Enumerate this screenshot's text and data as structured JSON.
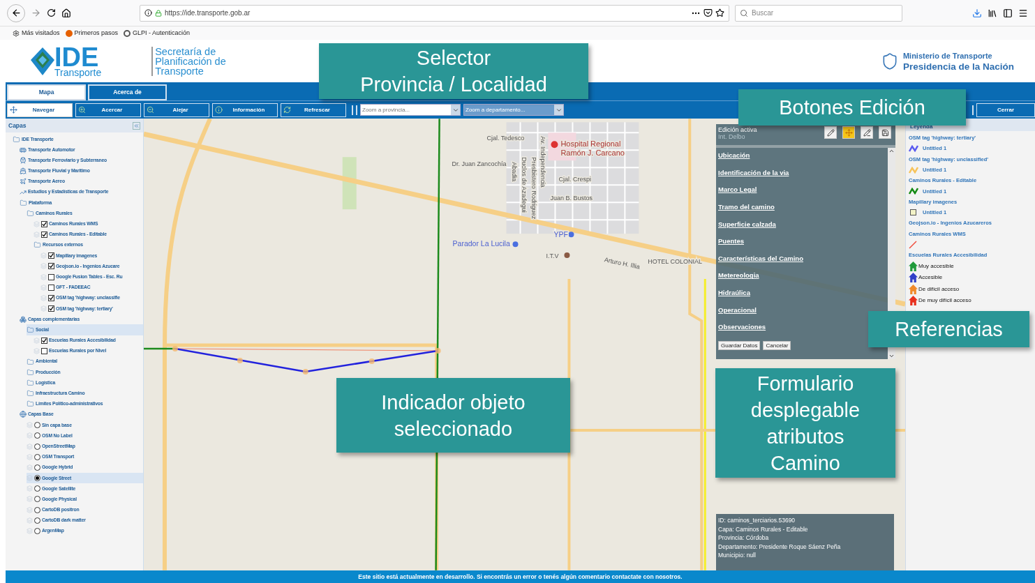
{
  "browser": {
    "url": "https://ide.transporte.gob.ar",
    "search": {
      "placeholder": "Buscar"
    },
    "bookmarks": [
      "Más visitados",
      "Primeros pasos",
      "GLPI - Autenticación"
    ]
  },
  "header": {
    "logo_main": "IDE",
    "logo_sub": "Transporte",
    "secretaria": [
      "Secretaría de",
      "Planificación de",
      "Transporte"
    ],
    "ministry": [
      "Ministerio de Transporte",
      "Presidencia de la Nación"
    ]
  },
  "tabs": [
    {
      "label": "Mapa",
      "selected": true
    },
    {
      "label": "Acerca de",
      "selected": false
    }
  ],
  "toolbar": {
    "tools": [
      {
        "label": "Navegar",
        "selected": true
      },
      {
        "label": "Acercar",
        "selected": false
      },
      {
        "label": "Alejar",
        "selected": false
      },
      {
        "label": "Información",
        "selected": false
      },
      {
        "label": "Refrescar",
        "selected": false
      }
    ],
    "selects": [
      {
        "placeholder": "Zoom a provincia..."
      },
      {
        "placeholder": "Zoom a departamento..."
      }
    ],
    "close": "Cerrar"
  },
  "layers": {
    "title": "Capas",
    "tree": [
      {
        "kind": "folder",
        "label": "IDE Transporte",
        "selected": false,
        "children": [
          {
            "kind": "theme",
            "label": "Transporte Automotor",
            "selected": false
          },
          {
            "kind": "theme",
            "label": "Transporte Ferroviario y Subterraneo",
            "selected": false
          },
          {
            "kind": "theme",
            "label": "Transporte Fluvial y Maritimo",
            "selected": false
          },
          {
            "kind": "theme",
            "label": "Transporte Aereo",
            "selected": false
          },
          {
            "kind": "theme",
            "label": "Estudios y Estadísticas de Transporte",
            "selected": false
          },
          {
            "kind": "folder",
            "label": "Plataforma",
            "selected": false,
            "children": [
              {
                "kind": "folder",
                "label": "Caminos Rurales",
                "selected": false,
                "children": [
                  {
                    "kind": "check",
                    "label": "Caminos Rurales WMS",
                    "checked": true,
                    "selected": false
                  },
                  {
                    "kind": "check",
                    "label": "Caminos Rurales - Editable",
                    "checked": true,
                    "selected": false
                  },
                  {
                    "kind": "folder",
                    "label": "Recursos externos",
                    "selected": false,
                    "children": [
                      {
                        "kind": "check",
                        "label": "Mapillary imagenes",
                        "checked": true,
                        "selected": false
                      },
                      {
                        "kind": "check",
                        "label": "Geojson.io - Ingenios Azucare",
                        "checked": true,
                        "selected": false
                      },
                      {
                        "kind": "check",
                        "label": "Google Fusion Tables - Esc. Ru",
                        "checked": false,
                        "selected": false
                      },
                      {
                        "kind": "check",
                        "label": "GFT - FADEEAC",
                        "checked": false,
                        "selected": false
                      },
                      {
                        "kind": "check",
                        "label": "OSM tag 'highway: unclassifie",
                        "checked": true,
                        "selected": false
                      },
                      {
                        "kind": "check",
                        "label": "OSM tag 'highway: tertiary'",
                        "checked": true,
                        "selected": false
                      }
                    ]
                  }
                ]
              }
            ]
          },
          {
            "kind": "theme",
            "label": "Capas complementarias",
            "selected": false,
            "children": [
              {
                "kind": "folder",
                "label": "Social",
                "selected": true,
                "children": [
                  {
                    "kind": "check",
                    "label": "Escuelas Rurales Accesibilidad",
                    "checked": true,
                    "selected": false
                  },
                  {
                    "kind": "check",
                    "label": "Escuelas Rurales por Nivel",
                    "checked": false,
                    "selected": false
                  }
                ]
              },
              {
                "kind": "folder",
                "label": "Ambiental",
                "selected": false
              },
              {
                "kind": "folder",
                "label": "Producción",
                "selected": false
              },
              {
                "kind": "folder",
                "label": "Logística",
                "selected": false
              },
              {
                "kind": "folder",
                "label": "Infraestructura Camino",
                "selected": false
              },
              {
                "kind": "folder",
                "label": "Límites Político-administrativos",
                "selected": false
              }
            ]
          },
          {
            "kind": "theme",
            "label": "Capas Base",
            "selected": false,
            "children": [
              {
                "kind": "radio",
                "label": "Sin capa base",
                "selected": false
              },
              {
                "kind": "radio",
                "label": "OSM No Label",
                "selected": false
              },
              {
                "kind": "radio",
                "label": "OpenStreetMap",
                "selected": false
              },
              {
                "kind": "radio",
                "label": "OSM Transport",
                "selected": false
              },
              {
                "kind": "radio",
                "label": "Google Hybrid",
                "selected": false
              },
              {
                "kind": "radio",
                "label": "Google Street",
                "selected": true
              },
              {
                "kind": "radio",
                "label": "Google Satellite",
                "selected": false
              },
              {
                "kind": "radio",
                "label": "Google Physical",
                "selected": false
              },
              {
                "kind": "radio",
                "label": "CartoDB positron",
                "selected": false
              },
              {
                "kind": "radio",
                "label": "CartoDB dark matter",
                "selected": false
              },
              {
                "kind": "radio",
                "label": "ArgenMap",
                "selected": false
              }
            ]
          }
        ]
      }
    ]
  },
  "map_labels": [
    "Cjal. Tedesco",
    "Hospital Regional",
    "Ramón J. Carcano",
    "Dr. Juan Zancochía",
    "Cjal. Crespi",
    "Juan B. Bustos",
    "YPF",
    "Parador La Lucila",
    "I.T.V",
    "HOTEL COLONIAL",
    "Arturo H. Illia",
    "Abadia",
    "Duclos de Azadegui",
    "Presbistero Rodriguez",
    "Av. Independencia"
  ],
  "edit_panel": {
    "title": "Edición activa",
    "subtitle": "Int. Delbo",
    "tools": [
      {
        "selected": false
      },
      {
        "selected": true
      },
      {
        "selected": false
      },
      {
        "selected": false
      }
    ],
    "sections": [
      "Ubicación",
      "Identificación de la via",
      "Marco Legal",
      "Tramo del camino",
      "Superficie calzada",
      "Puentes",
      "Características del Camino",
      "Metereologia",
      "Hidraúlica",
      "Operacional",
      "Observaciones"
    ],
    "buttons": [
      "Guardar Datos",
      "Cancelar"
    ]
  },
  "info_box": [
    "ID: caminos_terciarios.53690",
    "Capa: Caminos Rurales - Editable",
    "Provincia: Córdoba",
    "Departamento: Presidente Roque Sáenz Peña",
    "Municipio: null"
  ],
  "legend": {
    "title": "Leyenda",
    "items": [
      {
        "kind": "heading",
        "label": "OSM tag 'highway: tertiary'"
      },
      {
        "kind": "line",
        "label": "Untitled 1",
        "color": "#5b5bf0"
      },
      {
        "kind": "heading",
        "label": "OSM tag 'highway: unclassified'"
      },
      {
        "kind": "line",
        "label": "Untitled 1",
        "color": "#f7c35a"
      },
      {
        "kind": "heading",
        "label": "Caminos Rurales - Editable"
      },
      {
        "kind": "line",
        "label": "Untitled 1",
        "color": "#138a13"
      },
      {
        "kind": "heading",
        "label": "Mapillary imagenes"
      },
      {
        "kind": "square",
        "label": "Untitled 1",
        "color": "#f3f3c8"
      },
      {
        "kind": "heading",
        "label": "Geojson.io - Ingenios Azucareros"
      },
      {
        "kind": "heading",
        "label": "Caminos Rurales WMS"
      },
      {
        "kind": "slash",
        "color": "#f04a3a"
      },
      {
        "kind": "heading",
        "label": "Escuelas Rurales Accesibilidad"
      },
      {
        "kind": "house",
        "label": "Muy accesible",
        "color": "#1f9a3a"
      },
      {
        "kind": "house",
        "label": "Accesible",
        "color": "#3040c8"
      },
      {
        "kind": "house",
        "label": "De difícil acceso",
        "color": "#f08a2a"
      },
      {
        "kind": "house",
        "label": "De muy difícil acceso",
        "color": "#e8301e"
      }
    ]
  },
  "footer": "Este sitio está actualmente en desarrollo. Si encontrás un error o tenés algún comentario contactate con nosotros.",
  "callouts": [
    [
      "Selector",
      "Provincia / Localidad"
    ],
    [
      "Botones Edición"
    ],
    [
      "Referencias"
    ],
    [
      "Indicador objeto",
      "seleccionado"
    ],
    [
      "Formulario",
      "desplegable",
      "atributos",
      "Camino"
    ]
  ]
}
